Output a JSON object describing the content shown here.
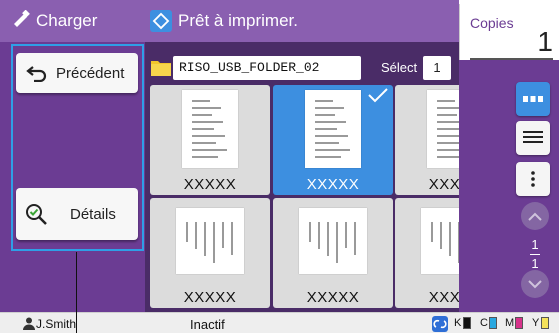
{
  "left": {
    "title": "Charger",
    "back_label": "Précédent",
    "details_label": "Détails"
  },
  "header": {
    "status_title": "Prêt à imprimer.",
    "copies_label": "Copies",
    "copies_value": "1"
  },
  "folder": {
    "name": "RISO_USB_FOLDER_02",
    "select_label": "Sélect",
    "select_value": "1"
  },
  "files": [
    {
      "name": "XXXXX",
      "selected": false
    },
    {
      "name": "XXXXX",
      "selected": true
    },
    {
      "name": "XXXXX",
      "selected": false
    },
    {
      "name": "XXXXX",
      "selected": false
    },
    {
      "name": "XXXXX",
      "selected": false
    },
    {
      "name": "XXXXX",
      "selected": false
    }
  ],
  "pager": {
    "current": "1",
    "total": "1"
  },
  "status": {
    "user": "J.Smith",
    "state": "Inactif",
    "inks": [
      "K",
      "C",
      "M",
      "Y"
    ]
  },
  "colors": {
    "purple_dark": "#6b3c93",
    "purple_header": "#8a5fb0",
    "accent_blue": "#3d8fe0",
    "frame_blue": "#2f9fe6",
    "ink_k": "#111111",
    "ink_c": "#29a8e0",
    "ink_m": "#d6338a",
    "ink_y": "#f5e25a"
  }
}
